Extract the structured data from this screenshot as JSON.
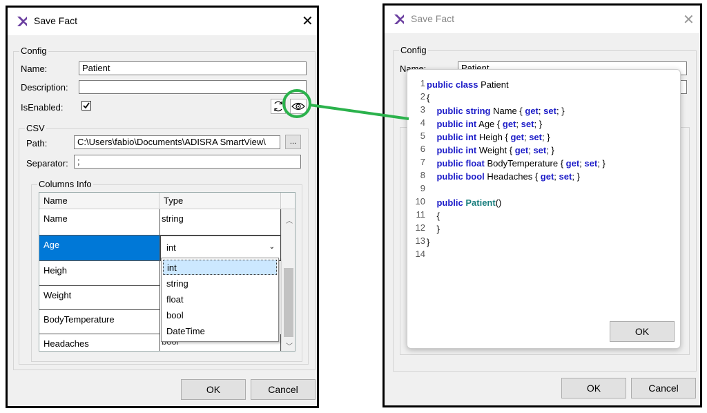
{
  "left_dialog": {
    "title": "Save Fact",
    "config_label": "Config",
    "name_label": "Name:",
    "name_value": "Patient",
    "description_label": "Description:",
    "description_value": "",
    "isenabled_label": "IsEnabled:",
    "isenabled_checked": true,
    "csv_label": "CSV",
    "path_label": "Path:",
    "path_value": "C:\\Users\\fabio\\Documents\\ADISRA SmartView\\",
    "browse_label": "...",
    "separator_label": "Separator:",
    "separator_value": ";",
    "columns_info_label": "Columns Info",
    "columns": {
      "name_header": "Name",
      "type_header": "Type"
    },
    "rows": [
      {
        "name": "Name",
        "type": "string"
      },
      {
        "name": "Age",
        "type": "int"
      },
      {
        "name": "Heigh",
        "type": ""
      },
      {
        "name": "Weight",
        "type": ""
      },
      {
        "name": "BodyTemperature",
        "type": ""
      },
      {
        "name": "Headaches",
        "type": "bool"
      }
    ],
    "dropdown": {
      "selected": "int",
      "options": [
        "int",
        "string",
        "float",
        "bool",
        "DateTime"
      ]
    },
    "ok_label": "OK",
    "cancel_label": "Cancel"
  },
  "right_dialog": {
    "title": "Save Fact",
    "config_label": "Config",
    "name_label": "Name:",
    "name_value": "Patient",
    "ok_label": "OK",
    "cancel_label": "Cancel",
    "popup_ok_label": "OK",
    "code_lines": [
      "public class Patient",
      "{",
      "    public string Name { get; set; }",
      "    public int Age { get; set; }",
      "    public int Heigh { get; set; }",
      "    public int Weight { get; set; }",
      "    public float BodyTemperature { get; set; }",
      "    public bool Headaches { get; set; }",
      "",
      "    public Patient()",
      "    {",
      "    }",
      "}",
      ""
    ]
  },
  "colors": {
    "highlight_green": "#2bb24c",
    "selection_blue": "#0078d7",
    "keyword_blue": "#1c1cc8"
  }
}
